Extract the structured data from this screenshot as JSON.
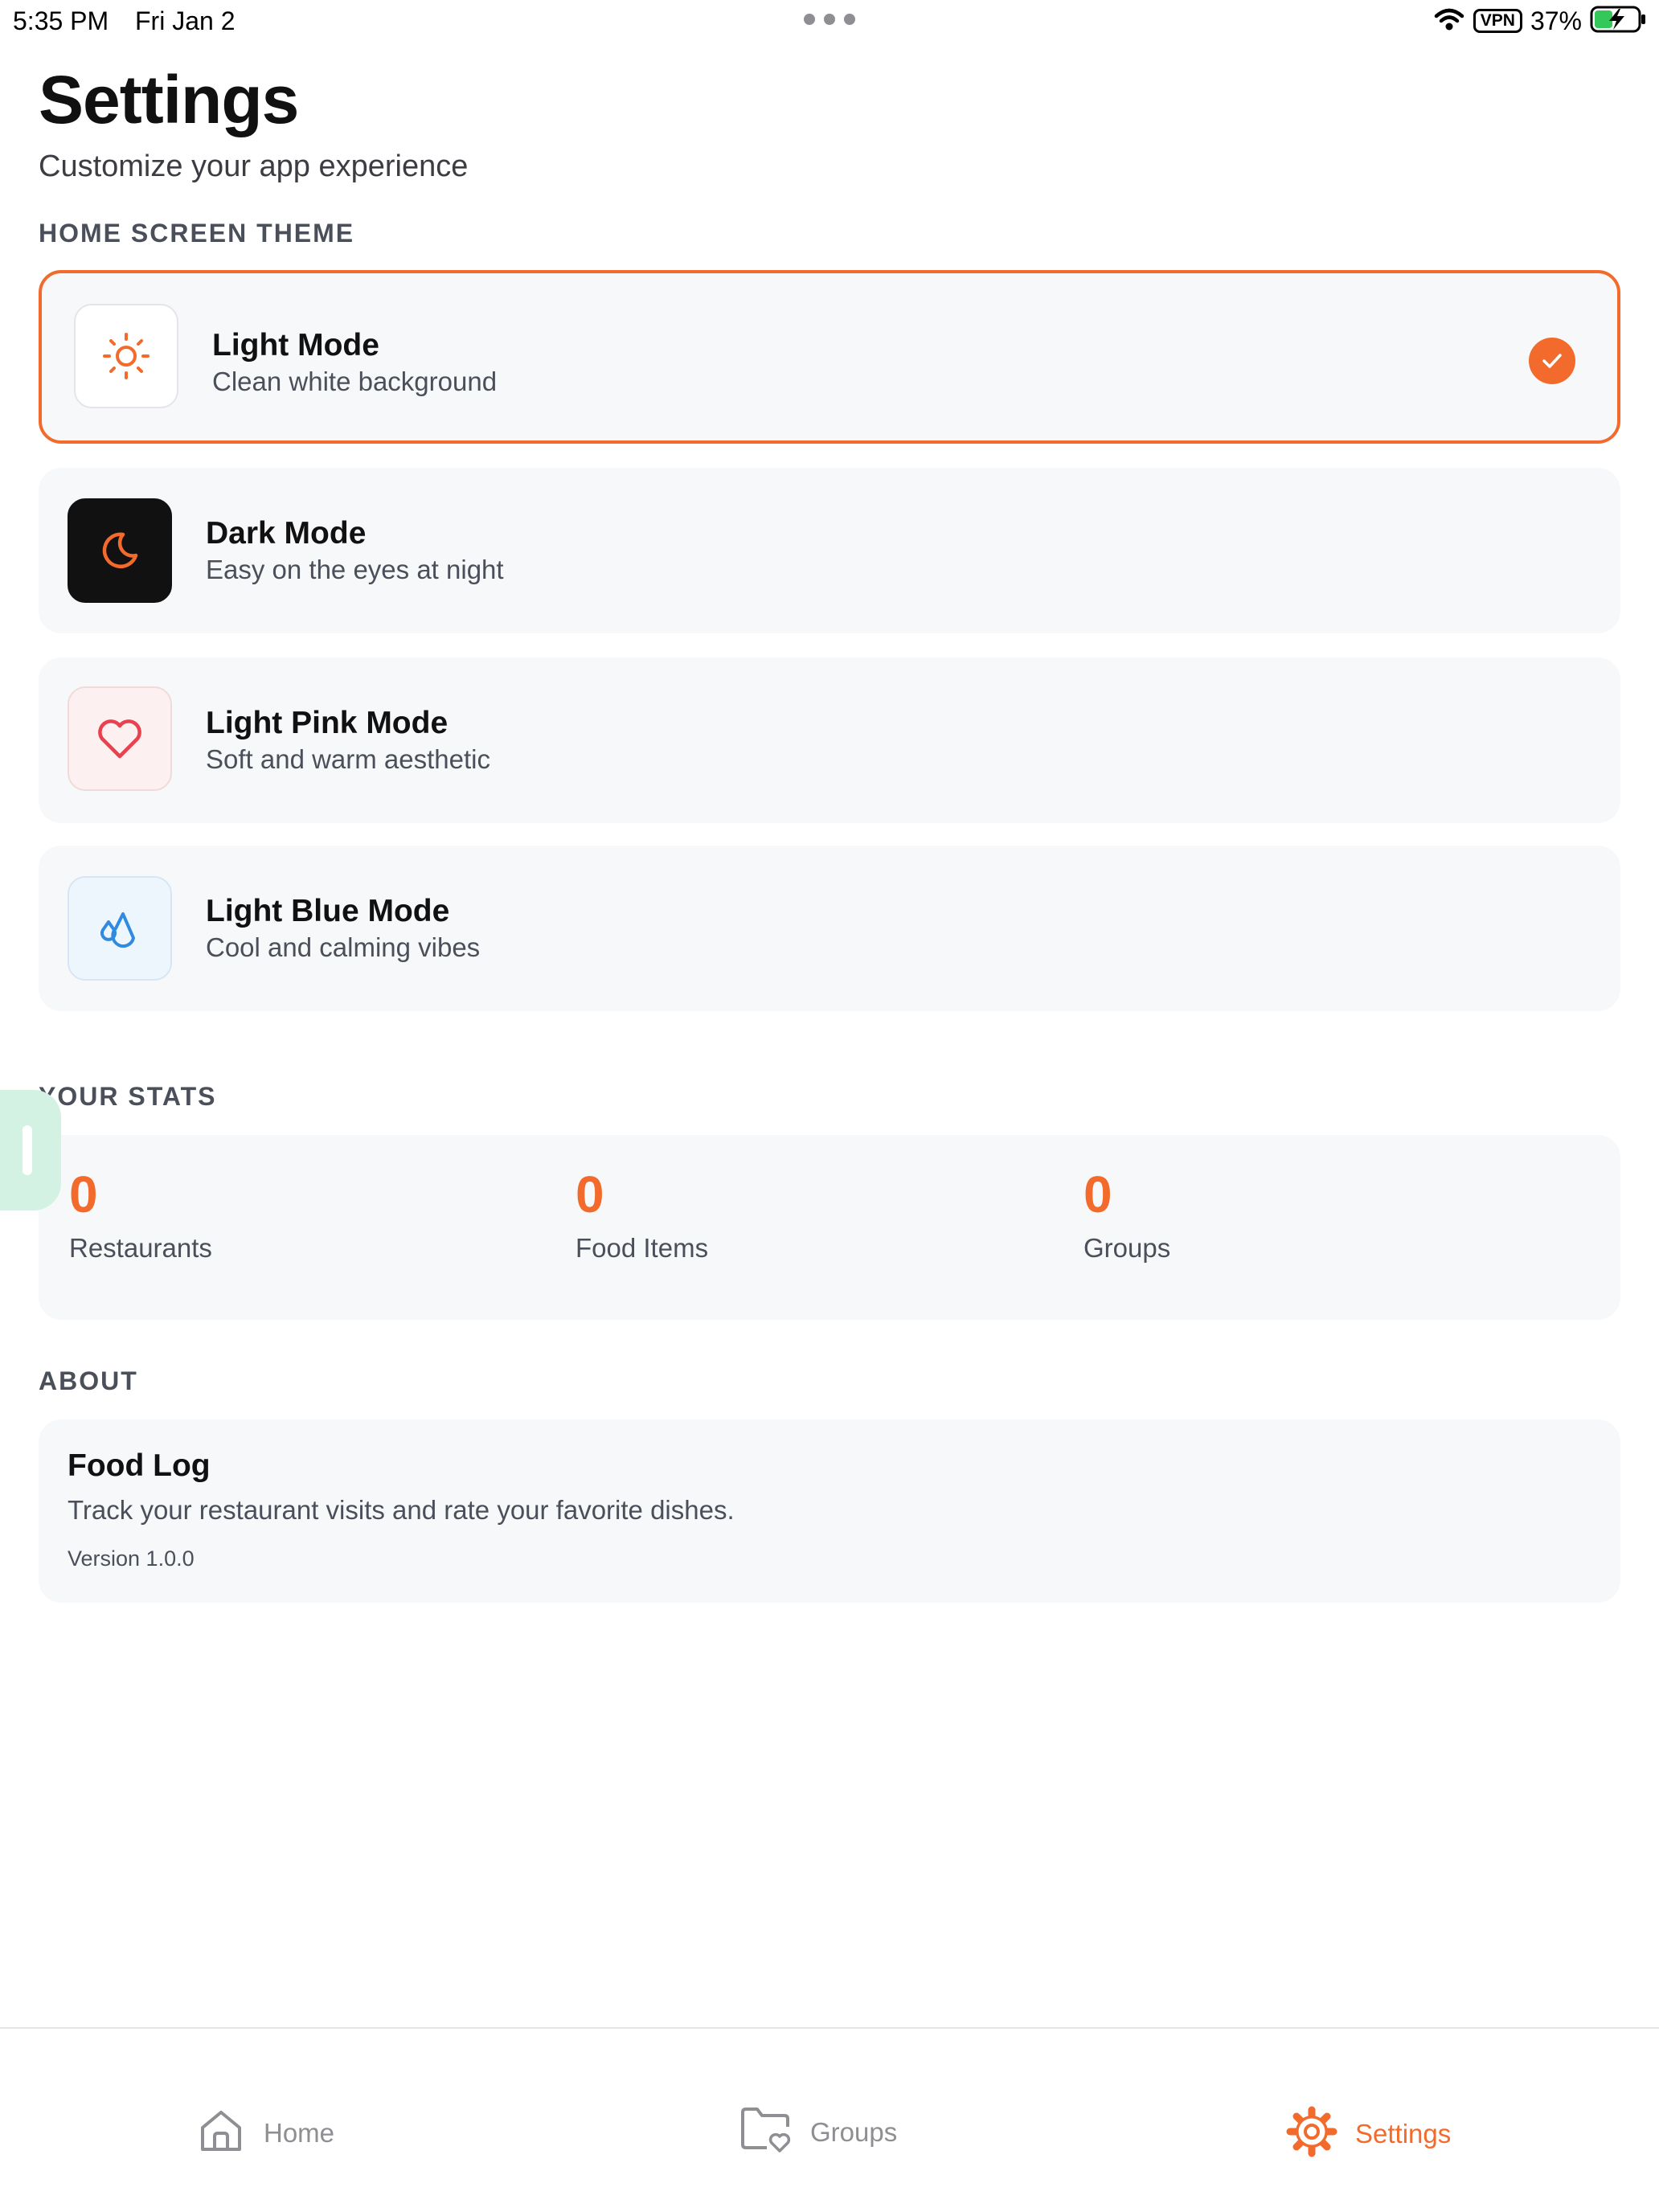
{
  "status_bar": {
    "time": "5:35 PM",
    "date": "Fri Jan 2",
    "vpn": "VPN",
    "battery": "37%"
  },
  "header": {
    "title": "Settings",
    "subtitle": "Customize your app experience"
  },
  "theme_section": {
    "heading": "HOME SCREEN THEME",
    "options": [
      {
        "title": "Light Mode",
        "description": "Clean white background",
        "icon": "sun-icon",
        "selected": true
      },
      {
        "title": "Dark Mode",
        "description": "Easy on the eyes at night",
        "icon": "moon-icon",
        "selected": false
      },
      {
        "title": "Light Pink Mode",
        "description": "Soft and warm aesthetic",
        "icon": "heart-icon",
        "selected": false
      },
      {
        "title": "Light Blue Mode",
        "description": "Cool and calming vibes",
        "icon": "droplets-icon",
        "selected": false
      }
    ]
  },
  "stats_section": {
    "heading": "YOUR STATS",
    "items": [
      {
        "value": "0",
        "label": "Restaurants"
      },
      {
        "value": "0",
        "label": "Food Items"
      },
      {
        "value": "0",
        "label": "Groups"
      }
    ]
  },
  "about_section": {
    "heading": "ABOUT",
    "app_name": "Food Log",
    "description": "Track your restaurant visits and rate your favorite dishes.",
    "version": "Version 1.0.0"
  },
  "tab_bar": {
    "items": [
      {
        "label": "Home",
        "icon": "home-icon",
        "active": false
      },
      {
        "label": "Groups",
        "icon": "folder-heart-icon",
        "active": false
      },
      {
        "label": "Settings",
        "icon": "gear-icon",
        "active": true
      }
    ]
  },
  "colors": {
    "accent": "#f26b2c",
    "card_background": "#f7f8fa",
    "muted_text": "#4a4f5a",
    "pink": "#e8414f",
    "blue": "#2f8ae0"
  }
}
